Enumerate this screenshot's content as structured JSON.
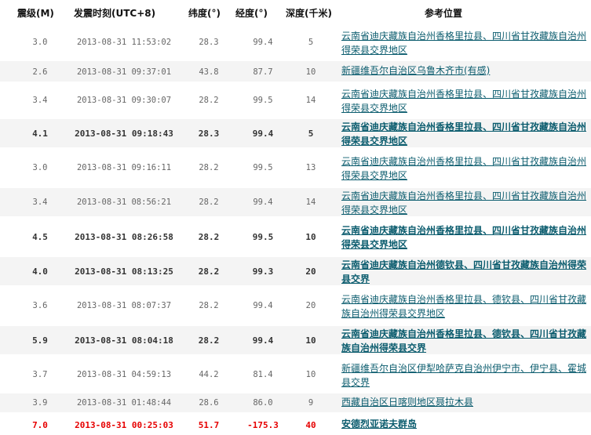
{
  "header": {
    "magnitude": "震级(M)",
    "time": "发震时刻(UTC+8)",
    "lat": "纬度(°)",
    "lon": "经度(°)",
    "depth": "深度(千米)",
    "location": "参考位置"
  },
  "rows": [
    {
      "mag": "3.0",
      "time": "2013-08-31 11:53:02",
      "lat": "28.3",
      "lon": "99.4",
      "depth": "5",
      "location": "云南省迪庆藏族自治州香格里拉县、四川省甘孜藏族自治州得荣县交界地区"
    },
    {
      "mag": "2.6",
      "time": "2013-08-31 09:37:01",
      "lat": "43.8",
      "lon": "87.7",
      "depth": "10",
      "location": "新疆维吾尔自治区乌鲁木齐市(有感)"
    },
    {
      "mag": "3.4",
      "time": "2013-08-31 09:30:07",
      "lat": "28.2",
      "lon": "99.5",
      "depth": "14",
      "location": "云南省迪庆藏族自治州香格里拉县、四川省甘孜藏族自治州得荣县交界地区"
    },
    {
      "mag": "4.1",
      "time": "2013-08-31 09:18:43",
      "lat": "28.3",
      "lon": "99.4",
      "depth": "5",
      "location": "云南省迪庆藏族自治州香格里拉县、四川省甘孜藏族自治州得荣县交界地区"
    },
    {
      "mag": "3.0",
      "time": "2013-08-31 09:16:11",
      "lat": "28.2",
      "lon": "99.5",
      "depth": "13",
      "location": "云南省迪庆藏族自治州香格里拉县、四川省甘孜藏族自治州得荣县交界地区"
    },
    {
      "mag": "3.4",
      "time": "2013-08-31 08:56:21",
      "lat": "28.2",
      "lon": "99.4",
      "depth": "14",
      "location": "云南省迪庆藏族自治州香格里拉县、四川省甘孜藏族自治州得荣县交界地区"
    },
    {
      "mag": "4.5",
      "time": "2013-08-31 08:26:58",
      "lat": "28.2",
      "lon": "99.5",
      "depth": "10",
      "location": "云南省迪庆藏族自治州香格里拉县、四川省甘孜藏族自治州得荣县交界地区"
    },
    {
      "mag": "4.0",
      "time": "2013-08-31 08:13:25",
      "lat": "28.2",
      "lon": "99.3",
      "depth": "20",
      "location": "云南省迪庆藏族自治州德钦县、四川省甘孜藏族自治州得荣县交界"
    },
    {
      "mag": "3.6",
      "time": "2013-08-31 08:07:37",
      "lat": "28.2",
      "lon": "99.4",
      "depth": "20",
      "location": "云南省迪庆藏族自治州香格里拉县、德钦县、四川省甘孜藏族自治州得荣县交界地区"
    },
    {
      "mag": "5.9",
      "time": "2013-08-31 08:04:18",
      "lat": "28.2",
      "lon": "99.4",
      "depth": "10",
      "location": "云南省迪庆藏族自治州香格里拉县、德钦县、四川省甘孜藏族自治州得荣县交界"
    },
    {
      "mag": "3.7",
      "time": "2013-08-31 04:59:13",
      "lat": "44.2",
      "lon": "81.4",
      "depth": "10",
      "location": "新疆维吾尔自治区伊犁哈萨克自治州伊宁市、伊宁县、霍城县交界"
    },
    {
      "mag": "3.9",
      "time": "2013-08-31 01:48:44",
      "lat": "28.6",
      "lon": "86.0",
      "depth": "9",
      "location": "西藏自治区日喀则地区聂拉木县"
    },
    {
      "mag": "7.0",
      "time": "2013-08-31 00:25:03",
      "lat": "51.7",
      "lon": "-175.3",
      "depth": "40",
      "location": "安德烈亚诺夫群岛"
    }
  ]
}
